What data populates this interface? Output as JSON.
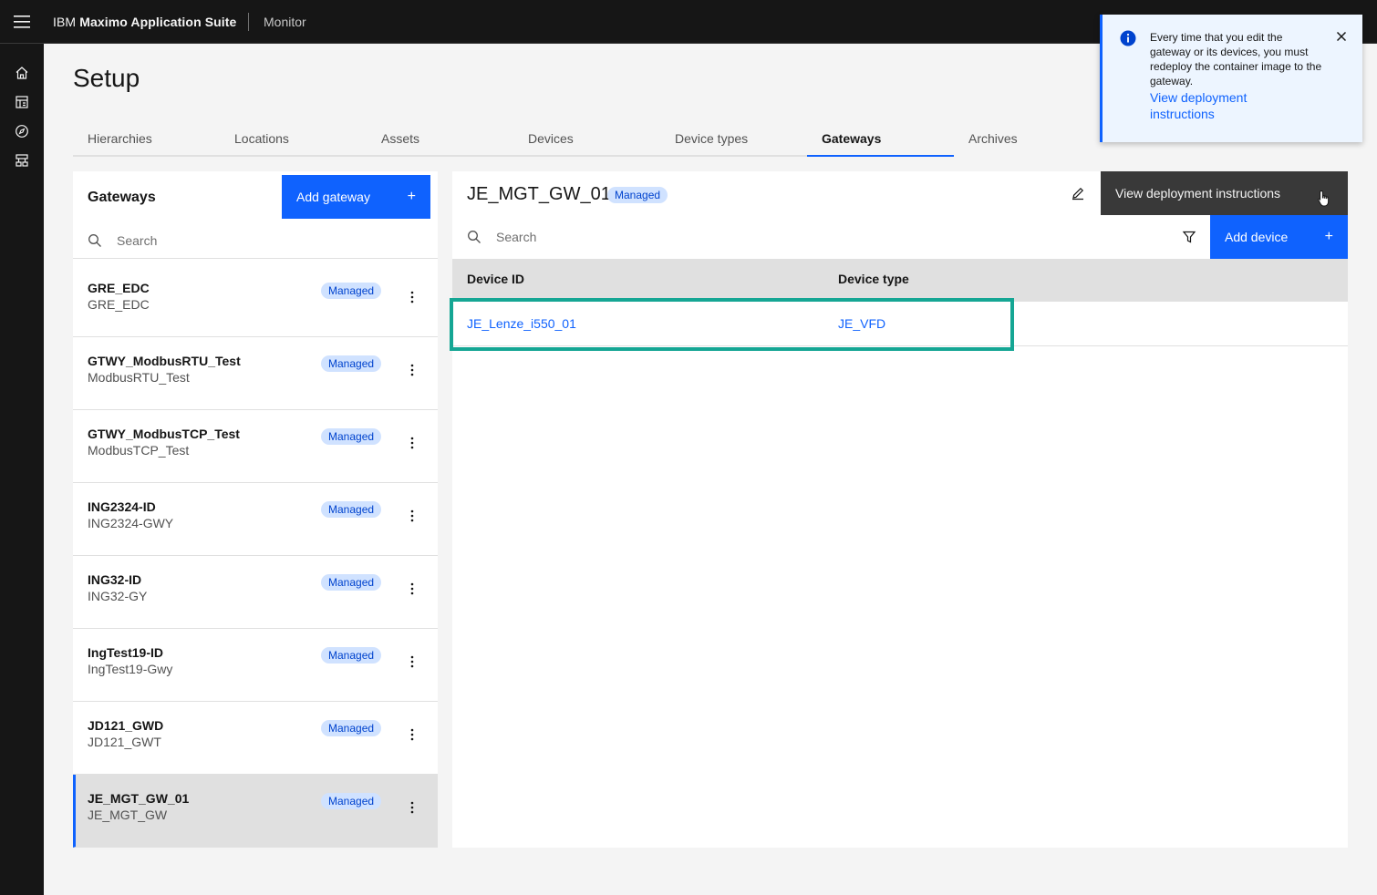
{
  "header": {
    "brand_prefix": "IBM",
    "brand_suite": "Maximo Application Suite",
    "app_name": "Monitor"
  },
  "page": {
    "title": "Setup"
  },
  "tabs": [
    {
      "label": "Hierarchies",
      "active": false
    },
    {
      "label": "Locations",
      "active": false
    },
    {
      "label": "Assets",
      "active": false
    },
    {
      "label": "Devices",
      "active": false
    },
    {
      "label": "Device types",
      "active": false
    },
    {
      "label": "Gateways",
      "active": true
    },
    {
      "label": "Archives",
      "active": false
    }
  ],
  "gateways_panel": {
    "title": "Gateways",
    "add_button_label": "Add gateway",
    "search_placeholder": "Search",
    "items": [
      {
        "name": "GRE_EDC",
        "sub": "GRE_EDC",
        "tag": "Managed",
        "selected": false
      },
      {
        "name": "GTWY_ModbusRTU_Test",
        "sub": "ModbusRTU_Test",
        "tag": "Managed",
        "selected": false
      },
      {
        "name": "GTWY_ModbusTCP_Test",
        "sub": "ModbusTCP_Test",
        "tag": "Managed",
        "selected": false
      },
      {
        "name": "ING2324-ID",
        "sub": "ING2324-GWY",
        "tag": "Managed",
        "selected": false
      },
      {
        "name": "ING32-ID",
        "sub": "ING32-GY",
        "tag": "Managed",
        "selected": false
      },
      {
        "name": "IngTest19-ID",
        "sub": "IngTest19-Gwy",
        "tag": "Managed",
        "selected": false
      },
      {
        "name": "JD121_GWD",
        "sub": "JD121_GWT",
        "tag": "Managed",
        "selected": false
      },
      {
        "name": "JE_MGT_GW_01",
        "sub": "JE_MGT_GW",
        "tag": "Managed",
        "selected": true
      }
    ]
  },
  "detail": {
    "title": "JE_MGT_GW_01",
    "tag": "Managed",
    "deploy_button_label": "View deployment instructions",
    "search_placeholder": "Search",
    "add_device_label": "Add device",
    "columns": [
      "Device ID",
      "Device type"
    ],
    "rows": [
      {
        "device_id": "JE_Lenze_i550_01",
        "device_type": "JE_VFD"
      }
    ]
  },
  "toast": {
    "message": "Every time that you edit the gateway or its devices, you must redeploy the container image to the gateway.",
    "link": "View deployment instructions"
  },
  "colors": {
    "primary": "#0f62fe",
    "highlight_border": "#15a694",
    "tag_bg": "#d0e2ff",
    "tag_text": "#0043ce",
    "header_bg": "#161616"
  }
}
